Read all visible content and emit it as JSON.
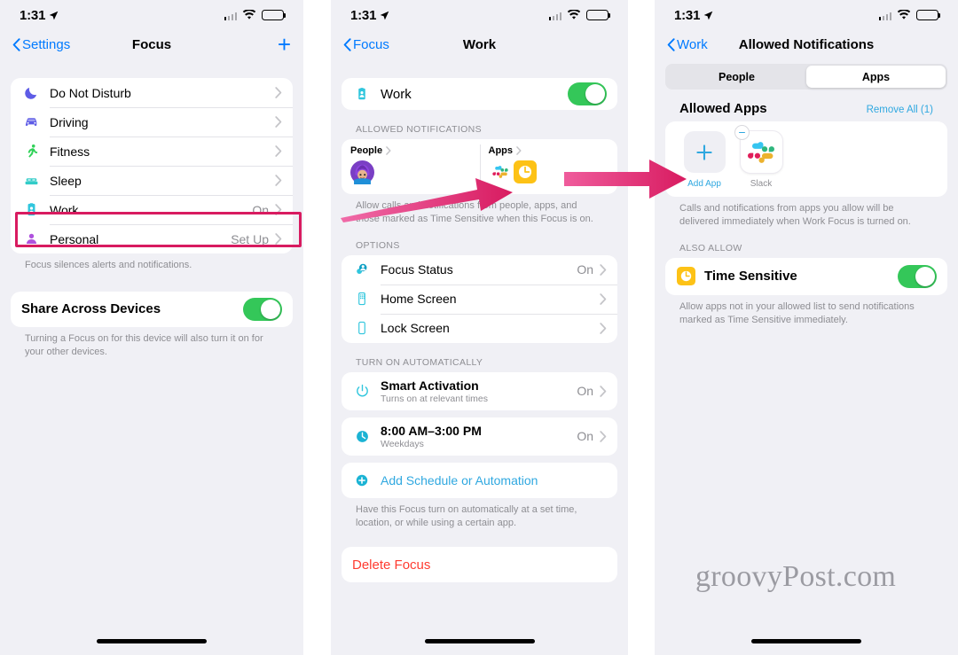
{
  "statusbar": {
    "time": "1:31",
    "location_icon": "location-arrow-icon",
    "cellular_icon": "cellular-bars-icon",
    "wifi_icon": "wifi-icon",
    "battery_icon": "battery-icon"
  },
  "watermark": "groovyPost.com",
  "colors": {
    "accent_blue": "#007aff",
    "light_blue": "#2fa8e0",
    "toggle_green": "#34c759",
    "annotation_pink": "#d81b60",
    "destructive_red": "#ff3b30",
    "gray_text": "#8e8e93"
  },
  "panel1": {
    "nav": {
      "back_label": "Settings",
      "title": "Focus",
      "add_label": "+"
    },
    "focus_items": [
      {
        "label": "Do Not Disturb",
        "value": "",
        "icon": "moon-icon"
      },
      {
        "label": "Driving",
        "value": "",
        "icon": "car-icon"
      },
      {
        "label": "Fitness",
        "value": "",
        "icon": "running-person-icon"
      },
      {
        "label": "Sleep",
        "value": "",
        "icon": "bed-icon"
      },
      {
        "label": "Work",
        "value": "On",
        "icon": "id-badge-icon"
      },
      {
        "label": "Personal",
        "value": "Set Up",
        "icon": "person-icon"
      }
    ],
    "footnote": "Focus silences alerts and notifications.",
    "share": {
      "label": "Share Across Devices",
      "state": "on"
    },
    "share_footnote": "Turning a Focus on for this device will also turn it on for your other devices."
  },
  "panel2": {
    "nav": {
      "back_label": "Focus",
      "title": "Work"
    },
    "master": {
      "label": "Work",
      "state": "on",
      "icon": "id-badge-icon"
    },
    "allowed_header": "ALLOWED NOTIFICATIONS",
    "people_tile": {
      "label": "People",
      "icon": "avatar-memoji-icon"
    },
    "apps_tile": {
      "label": "Apps",
      "icons": [
        "slack-icon",
        "time-sensitive-clock-icon"
      ]
    },
    "allowed_footnote": "Allow calls and notifications from people, apps, and those marked as Time Sensitive when this Focus is on.",
    "options_header": "OPTIONS",
    "options": [
      {
        "label": "Focus Status",
        "value": "On",
        "sub": "",
        "icon": "focus-status-icon"
      },
      {
        "label": "Home Screen",
        "value": "",
        "sub": "",
        "icon": "home-screen-icon"
      },
      {
        "label": "Lock Screen",
        "value": "",
        "sub": "",
        "icon": "lock-screen-icon"
      }
    ],
    "auto_header": "TURN ON AUTOMATICALLY",
    "automations": [
      {
        "label": "Smart Activation",
        "sub": "Turns on at relevant times",
        "value": "On",
        "icon": "power-icon"
      },
      {
        "label": "8:00 AM–3:00 PM",
        "sub": "Weekdays",
        "value": "On",
        "icon": "clock-icon"
      }
    ],
    "add_schedule": {
      "label": "Add Schedule or Automation",
      "icon": "plus-circle-icon"
    },
    "auto_footnote": "Have this Focus turn on automatically at a set time, location, or while using a certain app.",
    "delete": {
      "label": "Delete Focus"
    }
  },
  "panel3": {
    "nav": {
      "back_label": "Work",
      "title": "Allowed Notifications"
    },
    "segments": [
      {
        "label": "People",
        "active": false
      },
      {
        "label": "Apps",
        "active": true
      }
    ],
    "list_title": "Allowed Apps",
    "list_action": "Remove All (1)",
    "apps": [
      {
        "name": "Add App",
        "type": "add",
        "icon": "plus-icon"
      },
      {
        "name": "Slack",
        "type": "app",
        "icon": "slack-icon",
        "badge": "minus-badge-icon"
      }
    ],
    "apps_footnote": "Calls and notifications from apps you allow will be delivered immediately when Work Focus is turned on.",
    "also_allow_header": "ALSO ALLOW",
    "time_sensitive": {
      "label": "Time Sensitive",
      "state": "on",
      "icon": "time-sensitive-clock-icon"
    },
    "time_sensitive_footnote": "Allow apps not in your allowed list to send notifications marked as Time Sensitive immediately."
  }
}
